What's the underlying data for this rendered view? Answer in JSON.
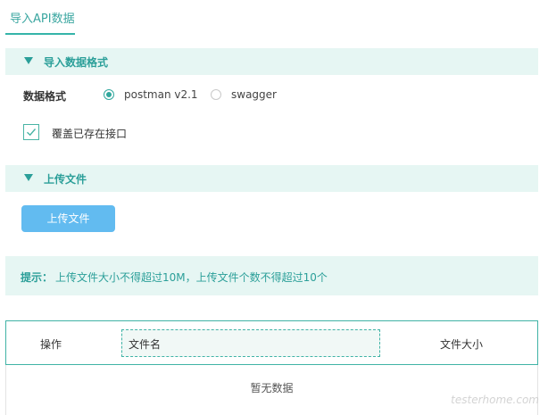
{
  "tab": {
    "label": "导入API数据"
  },
  "section_format": {
    "title": "导入数据格式"
  },
  "format": {
    "label": "数据格式",
    "options": [
      {
        "label": "postman v2.1",
        "selected": true
      },
      {
        "label": "swagger",
        "selected": false
      }
    ]
  },
  "overwrite": {
    "label": "覆盖已存在接口",
    "checked": true
  },
  "section_upload": {
    "title": "上传文件"
  },
  "upload_button": {
    "label": "上传文件"
  },
  "tip": {
    "prefix": "提示：",
    "text": "上传文件大小不得超过10M，上传文件个数不得超过10个"
  },
  "table": {
    "columns": [
      "操作",
      "文件名",
      "文件大小"
    ],
    "empty_text": "暂无数据"
  },
  "watermark": "testerhome.com",
  "colors": {
    "accent": "#2b9f99",
    "bar_bg": "#e6f6f3",
    "button": "#62bbf0"
  }
}
